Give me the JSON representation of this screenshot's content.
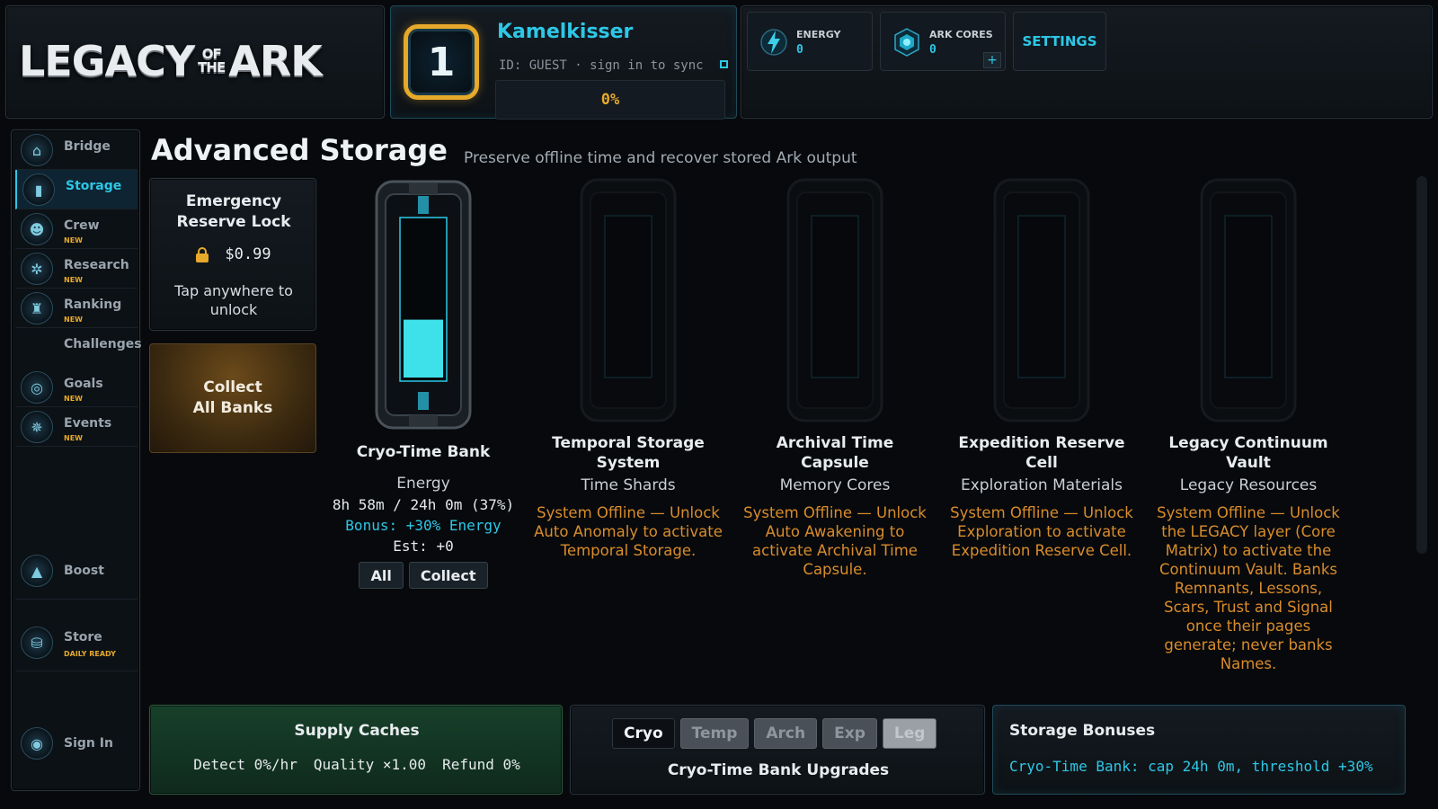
{
  "logo": {
    "part1": "LEGACY",
    "small_top": "OF",
    "small_bottom": "THE",
    "part2": "ARK"
  },
  "profile": {
    "level": "1",
    "name": "Kamelkisser",
    "id_line": "ID: GUEST · sign in to sync",
    "progress": "0%"
  },
  "resources": {
    "energy": {
      "label": "ENERGY",
      "value": "0",
      "icon": "lightning-icon"
    },
    "ark_cores": {
      "label": "ARK CORES",
      "value": "0",
      "icon": "core-gem-icon",
      "plus": "+"
    }
  },
  "settings_label": "SETTINGS",
  "sidebar": {
    "items": [
      {
        "label": "Bridge",
        "new": ""
      },
      {
        "label": "Storage",
        "new": ""
      },
      {
        "label": "Crew",
        "new": "NEW"
      },
      {
        "label": "Research",
        "new": "NEW"
      },
      {
        "label": "Ranking",
        "new": "NEW"
      }
    ],
    "challenges": "Challenges",
    "items2": [
      {
        "label": "Goals",
        "new": "NEW"
      },
      {
        "label": "Events",
        "new": "NEW"
      }
    ],
    "boost": "Boost",
    "store": {
      "label": "Store",
      "badge": "DAILY READY"
    },
    "sign_in": "Sign In"
  },
  "page": {
    "title": "Advanced Storage",
    "subtitle": "Preserve offline time and recover stored Ark output"
  },
  "lock_card": {
    "title_line1": "Emergency",
    "title_line2": "Reserve Lock",
    "price": "$0.99",
    "hint_line1": "Tap anywhere to",
    "hint_line2": "unlock"
  },
  "collect_all": {
    "line1": "Collect",
    "line2": "All Banks"
  },
  "banks": [
    {
      "name_line1": "Cryo-Time Bank",
      "name_line2": "",
      "resource": "Energy",
      "stat": "8h 58m / 24h 0m (37%)",
      "bonus": "Bonus: +30% Energy",
      "est": "Est: +0",
      "fill": 0.37,
      "btn_all": "All",
      "btn_collect": "Collect"
    },
    {
      "name_line1": "Temporal Storage",
      "name_line2": "System",
      "resource": "Time Shards",
      "offline": [
        "System Offline — Unlock",
        "Auto Anomaly to activate",
        "Temporal Storage."
      ]
    },
    {
      "name_line1": "Archival Time",
      "name_line2": "Capsule",
      "resource": "Memory Cores",
      "offline": [
        "System Offline — Unlock",
        "Auto Awakening to",
        "activate Archival Time",
        "Capsule."
      ]
    },
    {
      "name_line1": "Expedition Reserve",
      "name_line2": "Cell",
      "resource": "Exploration Materials",
      "offline": [
        "System Offline — Unlock",
        "Exploration to activate",
        "Expedition Reserve Cell."
      ]
    },
    {
      "name_line1": "Legacy Continuum",
      "name_line2": "Vault",
      "resource": "Legacy Resources",
      "offline": [
        "System Offline — Unlock",
        "the LEGACY layer (Core",
        "Matrix) to activate the",
        "Continuum Vault. Banks",
        "Remnants, Lessons,",
        "Scars, Trust and Signal",
        "once their pages",
        "generate; never banks",
        "Names."
      ]
    }
  ],
  "supply": {
    "title": "Supply Caches",
    "detect": "Detect 0%/hr",
    "quality": "Quality ×1.00",
    "refund": "Refund 0%"
  },
  "upgrades": {
    "tabs": [
      "Cryo",
      "Temp",
      "Arch",
      "Exp",
      "Leg"
    ],
    "title": "Cryo-Time Bank Upgrades"
  },
  "bonuses": {
    "title": "Storage Bonuses",
    "line": "Cryo-Time Bank: cap 24h 0m, threshold +30%"
  },
  "colors": {
    "accent": "#2ec7e6",
    "gold": "#e6a92a",
    "offline": "#d98c2b",
    "fill": "#3ee0ea"
  }
}
